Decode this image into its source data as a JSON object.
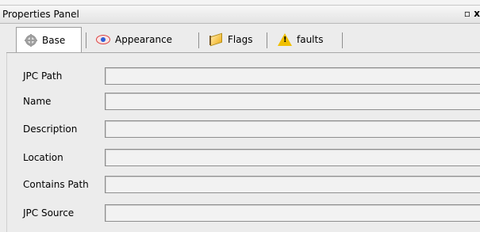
{
  "panel": {
    "title": "Properties Panel",
    "restore_icon": "▫",
    "close_icon": "x"
  },
  "tabs": [
    {
      "label": "Base",
      "icon": "gear-icon",
      "active": true
    },
    {
      "label": "Appearance",
      "icon": "eye-icon",
      "active": false
    },
    {
      "label": "Flags",
      "icon": "flag-icon",
      "active": false
    },
    {
      "label": "faults",
      "icon": "warning-icon",
      "active": false
    }
  ],
  "fields": [
    {
      "label": "JPC Path",
      "value": ""
    },
    {
      "label": "Name",
      "value": ""
    },
    {
      "label": "Description",
      "value": ""
    },
    {
      "label": "Location",
      "value": ""
    },
    {
      "label": "Contains Path",
      "value": ""
    },
    {
      "label": "JPC Source",
      "value": ""
    }
  ]
}
